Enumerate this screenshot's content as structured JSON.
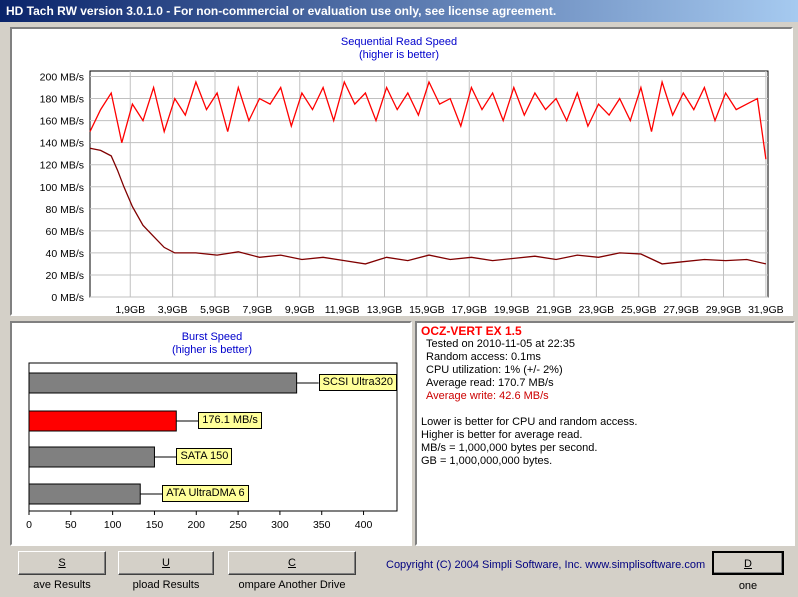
{
  "window": {
    "title": "HD Tach RW version 3.0.1.0  - For non-commercial or evaluation use only, see license agreement."
  },
  "colors": {
    "read_line": "#ff0000",
    "write_line": "#800000",
    "bar_gray": "#808080",
    "bar_red": "#ff0000",
    "label_bg": "#ffff99"
  },
  "sequential": {
    "title": "Sequential Read Speed",
    "subtitle": "(higher is better)",
    "y_ticks": [
      "200 MB/s",
      "180 MB/s",
      "160 MB/s",
      "140 MB/s",
      "120 MB/s",
      "100 MB/s",
      "80 MB/s",
      "60 MB/s",
      "40 MB/s",
      "20 MB/s",
      "0 MB/s"
    ],
    "x_ticks": [
      "1,9GB",
      "3,9GB",
      "5,9GB",
      "7,9GB",
      "9,9GB",
      "11,9GB",
      "13,9GB",
      "15,9GB",
      "17,9GB",
      "19,9GB",
      "21,9GB",
      "23,9GB",
      "25,9GB",
      "27,9GB",
      "29,9GB",
      "31,9GB"
    ]
  },
  "burst": {
    "title": "Burst Speed",
    "subtitle": "(higher is better)",
    "x_ticks": [
      "0",
      "50",
      "100",
      "150",
      "200",
      "250",
      "300",
      "350",
      "400"
    ],
    "bars": [
      {
        "label": "SCSI Ultra320",
        "value": 320,
        "color": "#808080"
      },
      {
        "label": "176.1 MB/s",
        "value": 176.1,
        "color": "#ff0000"
      },
      {
        "label": "SATA 150",
        "value": 150,
        "color": "#808080"
      },
      {
        "label": "ATA UltraDMA 6",
        "value": 133,
        "color": "#808080"
      }
    ]
  },
  "info": {
    "drive": "OCZ-VERT EX 1.5",
    "tested": "Tested on 2010-11-05 at 22:35",
    "random_access": "Random access: 0.1ms",
    "cpu": "CPU utilization: 1% (+/- 2%)",
    "avg_read": "Average read: 170.7 MB/s",
    "avg_write": "Average write: 42.6 MB/s",
    "notes": [
      "Lower is better for CPU and random access.",
      "Higher is better for average read.",
      "MB/s = 1,000,000 bytes per second.",
      "GB = 1,000,000,000 bytes."
    ]
  },
  "buttons": {
    "save_pre": "",
    "save_u": "S",
    "save_post": "ave Results",
    "upload_pre": "",
    "upload_u": "U",
    "upload_post": "pload Results",
    "compare_pre": "",
    "compare_u": "C",
    "compare_post": "ompare Another Drive",
    "done_pre": "",
    "done_u": "D",
    "done_post": "one"
  },
  "copyright": "Copyright (C) 2004 Simpli Software, Inc. www.simplisoftware.com",
  "chart_data": [
    {
      "type": "line",
      "title": "Sequential Read Speed",
      "subtitle": "(higher is better)",
      "ylabel": "",
      "xlabel": "",
      "ylim": [
        0,
        205
      ],
      "xlim": [
        0,
        32
      ],
      "y_unit": "MB/s",
      "x_unit": "GB",
      "grid": true,
      "series": [
        {
          "name": "",
          "x": [
            0,
            0.5,
            1,
            1.5,
            2,
            2.5,
            3,
            3.5,
            4,
            4.5,
            5,
            5.5,
            6,
            6.5,
            7,
            7.5,
            8,
            8.5,
            9,
            9.5,
            10,
            10.5,
            11,
            11.5,
            12,
            12.5,
            13,
            13.5,
            14,
            14.5,
            15,
            15.5,
            16,
            16.5,
            17,
            17.5,
            18,
            18.5,
            19,
            19.5,
            20,
            20.5,
            21,
            21.5,
            22,
            22.5,
            23,
            23.5,
            24,
            24.5,
            25,
            25.5,
            26,
            26.5,
            27,
            27.5,
            28,
            28.5,
            29,
            29.5,
            30,
            30.5,
            31,
            31.5,
            31.9
          ],
          "y": [
            150,
            170,
            185,
            140,
            175,
            160,
            190,
            150,
            180,
            165,
            195,
            170,
            185,
            150,
            190,
            160,
            180,
            175,
            190,
            155,
            185,
            170,
            190,
            160,
            195,
            175,
            185,
            160,
            190,
            170,
            185,
            165,
            195,
            175,
            180,
            155,
            190,
            170,
            185,
            160,
            190,
            165,
            185,
            170,
            180,
            160,
            185,
            155,
            175,
            165,
            180,
            160,
            190,
            150,
            195,
            165,
            185,
            170,
            190,
            160,
            185,
            170,
            175,
            180,
            125
          ]
        },
        {
          "name": "",
          "x": [
            0,
            0.5,
            1,
            1.3,
            1.6,
            2,
            2.5,
            3,
            3.5,
            4,
            5,
            6,
            7,
            8,
            9,
            10,
            11,
            12,
            13,
            14,
            15,
            16,
            17,
            18,
            19,
            20,
            21,
            22,
            23,
            24,
            25,
            26,
            27,
            28,
            29,
            30,
            31,
            31.9
          ],
          "y": [
            135,
            133,
            128,
            115,
            100,
            82,
            65,
            55,
            45,
            40,
            40,
            38,
            41,
            36,
            38,
            34,
            36,
            33,
            30,
            36,
            33,
            38,
            34,
            36,
            33,
            35,
            37,
            34,
            38,
            36,
            40,
            39,
            30,
            32,
            34,
            33,
            34,
            30
          ]
        }
      ]
    },
    {
      "type": "bar",
      "orientation": "horizontal",
      "title": "Burst Speed",
      "subtitle": "(higher is better)",
      "categories": [
        "SCSI Ultra320",
        "176.1 MB/s",
        "SATA 150",
        "ATA UltraDMA 6"
      ],
      "values": [
        320,
        176.1,
        150,
        133
      ],
      "xlim": [
        0,
        440
      ],
      "grid": false
    }
  ]
}
